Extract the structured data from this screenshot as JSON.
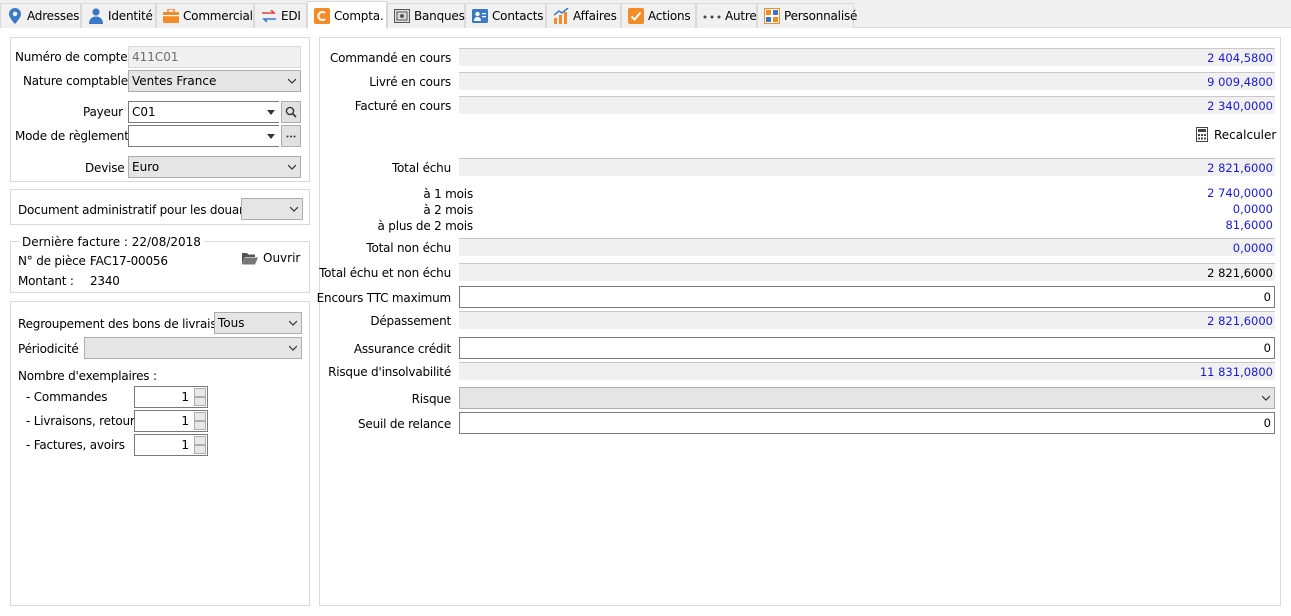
{
  "tabs": [
    {
      "label": "Adresses",
      "icon": "pin-icon",
      "active": false
    },
    {
      "label": "Identité",
      "icon": "person-icon",
      "active": false
    },
    {
      "label": "Commercial",
      "icon": "briefcase-icon",
      "active": false
    },
    {
      "label": "EDI",
      "icon": "exchange-icon",
      "active": false
    },
    {
      "label": "Compta.",
      "icon": "compta-icon",
      "active": true
    },
    {
      "label": "Banques",
      "icon": "safe-icon",
      "active": false
    },
    {
      "label": "Contacts",
      "icon": "contact-card-icon",
      "active": false
    },
    {
      "label": "Affaires",
      "icon": "chart-icon",
      "active": false
    },
    {
      "label": "Actions",
      "icon": "checkbox-icon",
      "active": false
    },
    {
      "label": "Autre",
      "icon": "dots-icon",
      "active": false
    },
    {
      "label": "Personnalisé",
      "icon": "custom-icon",
      "active": false
    }
  ],
  "account": {
    "numero_label": "Numéro de compte",
    "numero_value": "411C01",
    "nature_label": "Nature comptable",
    "nature_value": "Ventes France",
    "payeur_label": "Payeur",
    "payeur_value": "C01",
    "mode_label": "Mode de règlement",
    "mode_value": "",
    "devise_label": "Devise",
    "devise_value": "Euro"
  },
  "douane": {
    "label": "Document administratif pour les douanes",
    "value": ""
  },
  "last_invoice": {
    "legend": "Dernière facture : 22/08/2018",
    "piece_label": "N° de pièce :",
    "piece_value": "FAC17-00056",
    "montant_label": "Montant :",
    "montant_value": "2340",
    "open_label": "Ouvrir"
  },
  "printing": {
    "regroupement_label": "Regroupement des bons de livraison",
    "regroupement_value": "Tous",
    "periodicite_label": "Périodicité",
    "periodicite_value": "",
    "exemplaires_label": "Nombre d'exemplaires :",
    "commandes_label": "- Commandes",
    "commandes_value": "1",
    "livraisons_label": "- Livraisons, retours",
    "livraisons_value": "1",
    "factures_label": "- Factures, avoirs",
    "factures_value": "1"
  },
  "totals": {
    "commande_label": "Commandé en cours",
    "commande_value": "2 404,5800",
    "livre_label": "Livré en cours",
    "livre_value": "9 009,4800",
    "facture_label": "Facturé en cours",
    "facture_value": "2 340,0000",
    "recalc_label": "Recalculer",
    "echu_label": "Total échu",
    "echu_value": "2 821,6000",
    "m1_label": "à 1 mois",
    "m1_value": "2 740,0000",
    "m2_label": "à 2 mois",
    "m2_value": "0,0000",
    "mplus_label": "à plus de 2 mois",
    "mplus_value": "81,6000",
    "non_echu_label": "Total non échu",
    "non_echu_value": "0,0000",
    "echu_non_echu_label": "Total échu et non échu",
    "echu_non_echu_value": "2 821,6000",
    "encours_label": "Encours TTC maximum",
    "encours_value": "0",
    "depassement_label": "Dépassement",
    "depassement_value": "2 821,6000",
    "assurance_label": "Assurance crédit",
    "assurance_value": "0",
    "risque_insolv_label": "Risque d'insolvabilité",
    "risque_insolv_value": "11 831,0800",
    "risque_label": "Risque",
    "risque_value": "",
    "seuil_label": "Seuil de relance",
    "seuil_value": "0"
  },
  "colors": {
    "accent_orange": "#f28c28",
    "value_blue": "#1a1ad6",
    "field_bg": "#f0f0f0",
    "border": "#d9d9d9"
  }
}
